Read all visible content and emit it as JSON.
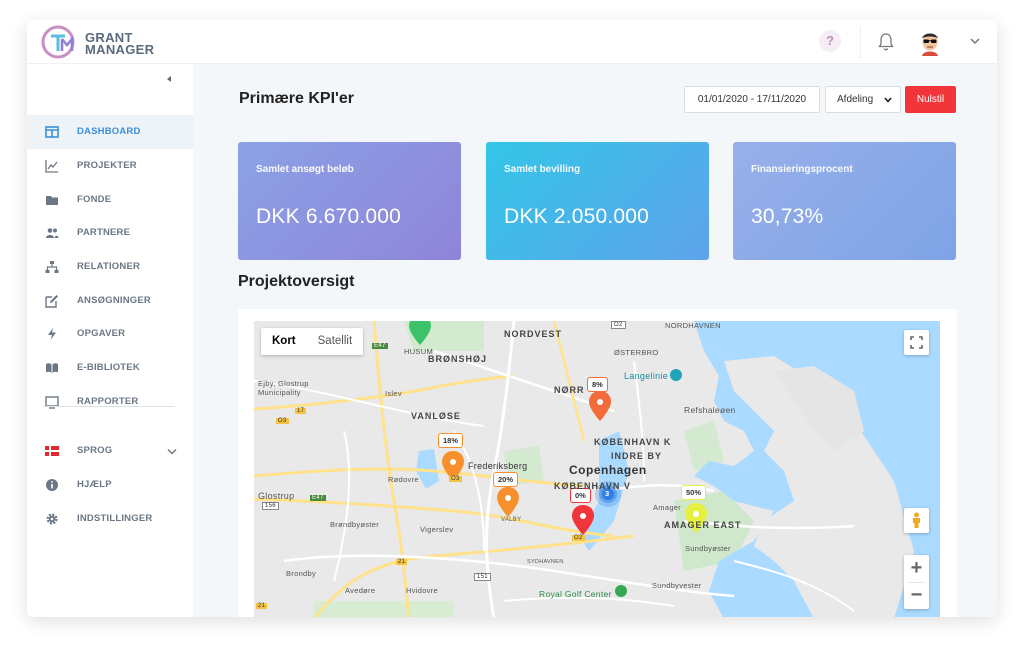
{
  "app": {
    "logo_line1": "GRANT",
    "logo_line2": "MANAGER",
    "help_label": "?"
  },
  "sidebar": {
    "items": [
      {
        "label": "DASHBOARD",
        "icon": "dashboard-icon",
        "active": true
      },
      {
        "label": "PROJEKTER",
        "icon": "chart-line-icon"
      },
      {
        "label": "FONDE",
        "icon": "folder-icon"
      },
      {
        "label": "PARTNERE",
        "icon": "users-icon"
      },
      {
        "label": "RELATIONER",
        "icon": "sitemap-icon"
      },
      {
        "label": "ANSØGNINGER",
        "icon": "edit-icon"
      },
      {
        "label": "OPGAVER",
        "icon": "bolt-icon"
      },
      {
        "label": "E-BIBLIOTEK",
        "icon": "book-icon"
      },
      {
        "label": "RAPPORTER",
        "icon": "monitor-icon"
      },
      {
        "label": "SPROG",
        "icon": "danish-flag-icon"
      },
      {
        "label": "HJÆLP",
        "icon": "info-icon"
      },
      {
        "label": "INDSTILLINGER",
        "icon": "gear-icon"
      }
    ]
  },
  "main": {
    "title": "Primære KPI'er",
    "date_range": "01/01/2020 - 17/11/2020",
    "department_select": "Afdeling",
    "reset_label": "Nulstil",
    "kpis": [
      {
        "label": "Samlet ansøgt beløb",
        "value": "DKK 6.670.000"
      },
      {
        "label": "Samlet bevilling",
        "value": "DKK 2.050.000"
      },
      {
        "label": "Finansieringsprocent",
        "value": "30,73%"
      }
    ],
    "section_title": "Projektoversigt"
  },
  "map": {
    "type_map": "Kort",
    "type_satellite": "Satellit",
    "zoom_in": "+",
    "zoom_out": "−",
    "labels": {
      "nordvest": "NORDVEST",
      "bronshoj": "BRØNSHØJ",
      "husum": "HUSUM",
      "nordhavnen": "NORDHAVNEN",
      "osterbro": "ØSTERBRO",
      "ejby": "Ejby, Glostrup",
      "municipality": "Municipality",
      "islev": "Islev",
      "norr": "NØRR",
      "langelinie": "Langelinie",
      "vanlose": "VANLØSE",
      "refshaleoen": "Refshaleøen",
      "kobenhavn_k": "KØBENHAVN K",
      "indre_by": "INDRE BY",
      "frederiksberg": "Frederiksberg",
      "copenhagen": "Copenhagen",
      "rodovre": "Rødovre",
      "kobenhavn_v": "KØBENHAVN V",
      "glostrup": "Glostrup",
      "amager": "Amager",
      "amager_east": "AMAGER EAST",
      "valby": "VALBY",
      "brondbyoster": "Brøndbyøster",
      "vigerslev": "Vigerslev",
      "sundbyoster": "Sundbyøster",
      "sydhavnen": "SYDHAVNEN",
      "brondby": "Brondby",
      "avedore": "Avedøre",
      "hvidovre": "Hvidovre",
      "royal_golf": "Royal Golf Center",
      "sundbyvester": "Sundbyvester",
      "road_e47a": "E47",
      "road_e47b": "E47",
      "road_17": "17",
      "road_o3a": "O3",
      "road_o3b": "O3",
      "road_o2a": "O2",
      "road_o2b": "O2",
      "road_156": "156",
      "road_21": "21",
      "road_151": "151",
      "road_21b": "21"
    },
    "markers": [
      {
        "pct": "8%",
        "color": "#f26b3a"
      },
      {
        "pct": "18%",
        "color": "#f7902c"
      },
      {
        "pct": "20%",
        "color": "#f7902c"
      },
      {
        "pct": "0%",
        "color": "#f1353b"
      },
      {
        "pct": "50%",
        "color": "#e6f040"
      },
      {
        "cluster": "3",
        "color": "#2f7de0"
      }
    ]
  }
}
